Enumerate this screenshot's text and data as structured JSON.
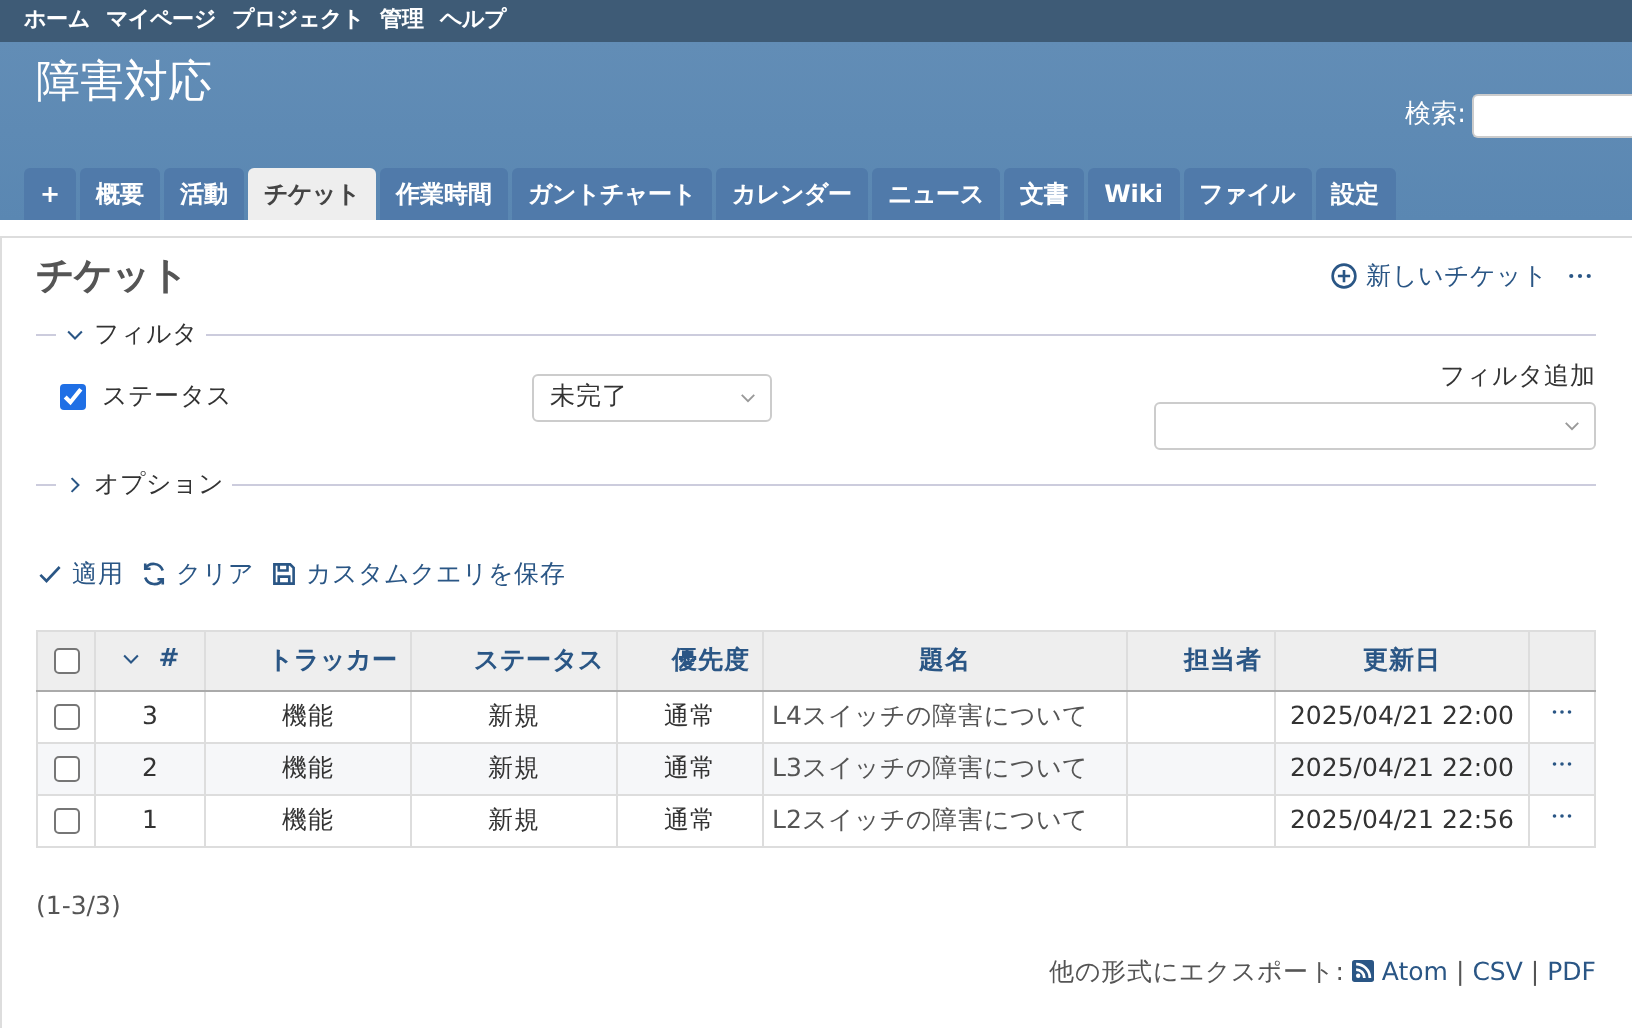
{
  "top_menu": [
    "ホーム",
    "マイページ",
    "プロジェクト",
    "管理",
    "ヘルプ"
  ],
  "project_title": "障害対応",
  "search": {
    "label": "検索:"
  },
  "tabs": [
    {
      "label": "+",
      "selected": false
    },
    {
      "label": "概要",
      "selected": false
    },
    {
      "label": "活動",
      "selected": false
    },
    {
      "label": "チケット",
      "selected": true
    },
    {
      "label": "作業時間",
      "selected": false
    },
    {
      "label": "ガントチャート",
      "selected": false
    },
    {
      "label": "カレンダー",
      "selected": false
    },
    {
      "label": "ニュース",
      "selected": false
    },
    {
      "label": "文書",
      "selected": false
    },
    {
      "label": "Wiki",
      "selected": false
    },
    {
      "label": "ファイル",
      "selected": false
    },
    {
      "label": "設定",
      "selected": false
    }
  ],
  "page_title": "チケット",
  "new_issue": "新しいチケット",
  "filters": {
    "legend": "フィルタ",
    "expanded": true,
    "rows": [
      {
        "label": "ステータス",
        "checked": true,
        "value": "未完了"
      }
    ],
    "add_label": "フィルタ追加"
  },
  "options": {
    "legend": "オプション",
    "expanded": false
  },
  "buttons": [
    {
      "kind": "apply",
      "label": "適用"
    },
    {
      "kind": "clear",
      "label": "クリア"
    },
    {
      "kind": "save",
      "label": "カスタムクエリを保存"
    }
  ],
  "table": {
    "select_all": {
      "checked": false
    },
    "columns": [
      {
        "label": "#",
        "sorted": true
      },
      {
        "label": "トラッカー",
        "sorted": false
      },
      {
        "label": "ステータス",
        "sorted": false
      },
      {
        "label": "優先度",
        "sorted": false
      },
      {
        "label": "題名",
        "sorted": false
      },
      {
        "label": "担当者",
        "sorted": false
      },
      {
        "label": "更新日",
        "sorted": false
      }
    ],
    "rows": [
      {
        "checked": false,
        "cells": [
          "3",
          "機能",
          "新規",
          "通常",
          "L4スイッチの障害について",
          "",
          "2025/04/21 22:00"
        ]
      },
      {
        "checked": false,
        "cells": [
          "2",
          "機能",
          "新規",
          "通常",
          "L3スイッチの障害について",
          "",
          "2025/04/21 22:00"
        ]
      },
      {
        "checked": false,
        "cells": [
          "1",
          "機能",
          "新規",
          "通常",
          "L2スイッチの障害について",
          "",
          "2025/04/21 22:56"
        ]
      }
    ]
  },
  "count": "(1-3/3)",
  "export": {
    "label": "他の形式にエクスポート:",
    "separator": "|",
    "links": [
      {
        "label": "Atom",
        "kind": "feed"
      },
      {
        "label": "CSV",
        "kind": "plain"
      },
      {
        "label": "PDF",
        "kind": "plain"
      }
    ]
  }
}
